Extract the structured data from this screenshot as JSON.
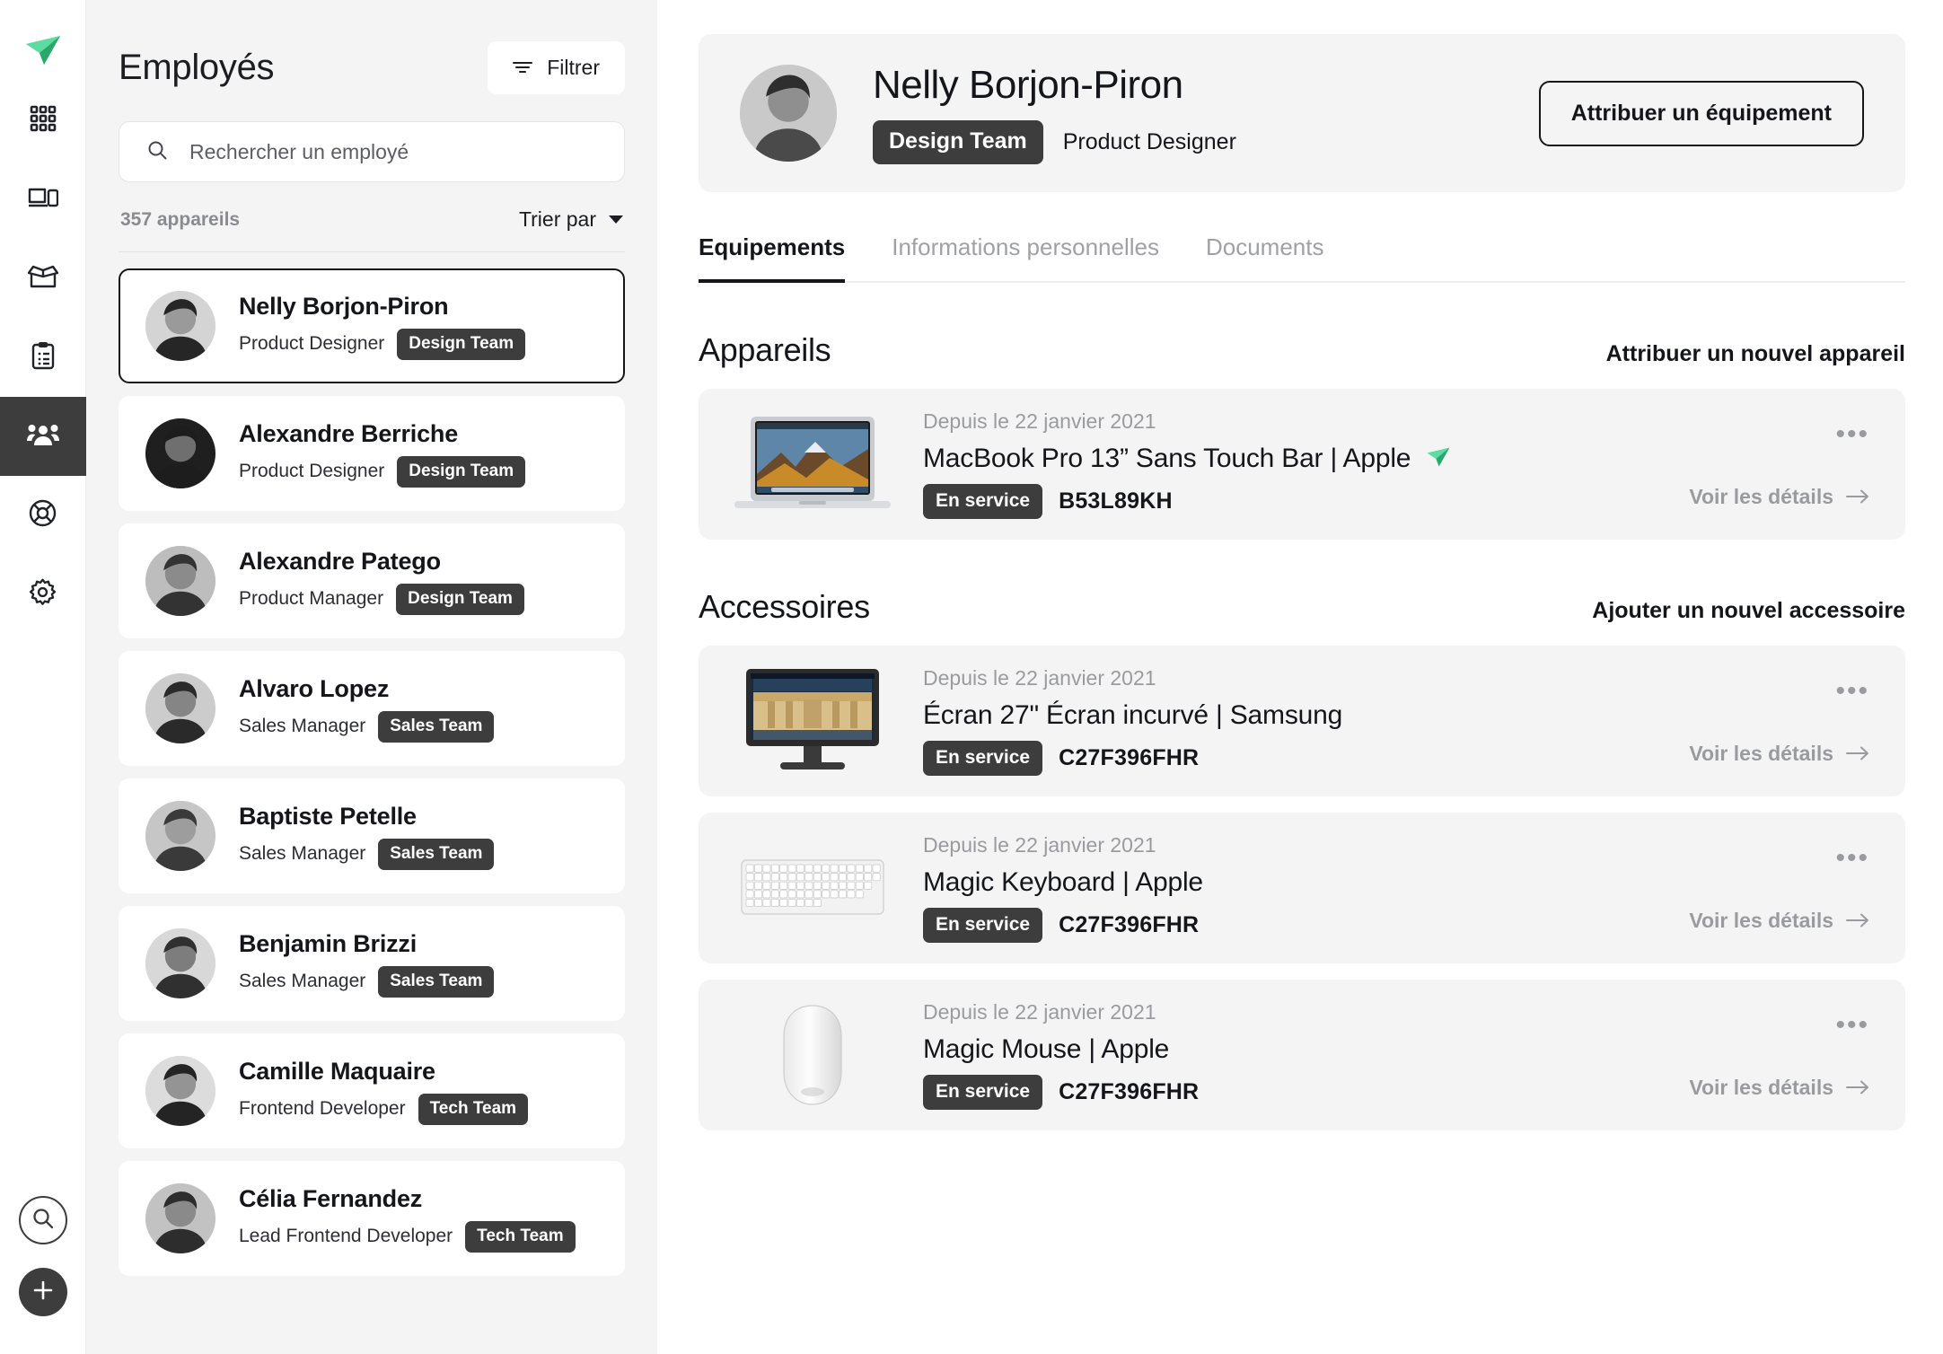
{
  "rail": {
    "logo_icon": "paper-plane-logo",
    "items": [
      {
        "icon": "grid-apps-icon",
        "name": "apps",
        "active": false
      },
      {
        "icon": "devices-icon",
        "name": "devices",
        "active": false
      },
      {
        "icon": "open-box-icon",
        "name": "inventory",
        "active": false
      },
      {
        "icon": "clipboard-icon",
        "name": "requests",
        "active": false
      },
      {
        "icon": "people-icon",
        "name": "employees",
        "active": true
      },
      {
        "icon": "lifebuoy-icon",
        "name": "support",
        "active": false
      },
      {
        "icon": "gear-icon",
        "name": "settings",
        "active": false
      }
    ],
    "bottom": [
      {
        "icon": "search-circle-icon",
        "name": "global-search"
      },
      {
        "icon": "plus-icon",
        "name": "create-new"
      }
    ]
  },
  "panel": {
    "title": "Employés",
    "filter_label": "Filtrer",
    "filter_icon": "filter-icon",
    "search_placeholder": "Rechercher un employé",
    "search_value": "",
    "search_icon": "search-icon",
    "count_label": "357 appareils",
    "sort_label": "Trier par",
    "employees": [
      {
        "name": "Nelly Borjon-Piron",
        "role": "Product Designer",
        "team": "Design Team",
        "selected": true
      },
      {
        "name": "Alexandre Berriche",
        "role": "Product Designer",
        "team": "Design Team",
        "selected": false
      },
      {
        "name": "Alexandre Patego",
        "role": "Product Manager",
        "team": "Design Team",
        "selected": false
      },
      {
        "name": "Alvaro Lopez",
        "role": "Sales Manager",
        "team": "Sales Team",
        "selected": false
      },
      {
        "name": "Baptiste Petelle",
        "role": "Sales Manager",
        "team": "Sales Team",
        "selected": false
      },
      {
        "name": "Benjamin Brizzi",
        "role": "Sales Manager",
        "team": "Sales Team",
        "selected": false
      },
      {
        "name": "Camille Maquaire",
        "role": "Frontend Developer",
        "team": "Tech Team",
        "selected": false
      },
      {
        "name": "Célia Fernandez",
        "role": "Lead Frontend Developer",
        "team": "Tech Team",
        "selected": false
      }
    ]
  },
  "profile": {
    "name": "Nelly Borjon-Piron",
    "team": "Design Team",
    "role": "Product Designer",
    "assign_button": "Attribuer un équipement",
    "avatar_icon": "avatar"
  },
  "tabs": [
    {
      "label": "Equipements",
      "active": true
    },
    {
      "label": "Informations personnelles",
      "active": false
    },
    {
      "label": "Documents",
      "active": false
    }
  ],
  "sections": [
    {
      "title": "Appareils",
      "action": "Attribuer un nouvel appareil",
      "items": [
        {
          "date": "Depuis le 22 janvier 2021",
          "title": "MacBook Pro 13” Sans Touch Bar | Apple",
          "badge_icon": "paper-plane-logo",
          "state": "En service",
          "serial": "B53L89KH",
          "details": "Voir les détails",
          "thumb": "macbook",
          "more_icon": "ellipsis-icon",
          "arrow_icon": "arrow-right-icon"
        }
      ]
    },
    {
      "title": "Accessoires",
      "action": "Ajouter un nouvel accessoire",
      "items": [
        {
          "date": "Depuis le 22 janvier 2021",
          "title": "Écran 27\" Écran incurvé | Samsung",
          "badge_icon": "",
          "state": "En service",
          "serial": "C27F396FHR",
          "details": "Voir les détails",
          "thumb": "monitor",
          "more_icon": "ellipsis-icon",
          "arrow_icon": "arrow-right-icon"
        },
        {
          "date": "Depuis le 22 janvier 2021",
          "title": "Magic Keyboard | Apple",
          "badge_icon": "",
          "state": "En service",
          "serial": "C27F396FHR",
          "details": "Voir les détails",
          "thumb": "keyboard",
          "more_icon": "ellipsis-icon",
          "arrow_icon": "arrow-right-icon"
        },
        {
          "date": "Depuis le 22 janvier 2021",
          "title": "Magic Mouse | Apple",
          "badge_icon": "",
          "state": "En service",
          "serial": "C27F396FHR",
          "details": "Voir les détails",
          "thumb": "mouse",
          "more_icon": "ellipsis-icon",
          "arrow_icon": "arrow-right-icon"
        }
      ]
    }
  ],
  "colors": {
    "brand_green": "#35c37d",
    "chip_dark": "#3d3d3d",
    "panel_bg": "#f4f4f4",
    "text_primary": "#15161a",
    "text_muted": "#9a9b9f"
  },
  "ellipsis": "•••"
}
